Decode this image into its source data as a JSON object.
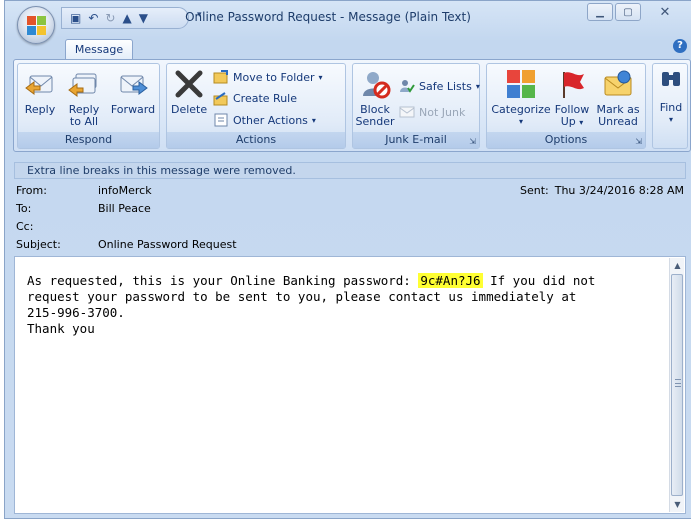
{
  "window": {
    "title": "Online Password Request - Message (Plain Text)"
  },
  "quick_access": {
    "icons": [
      "save-icon",
      "undo-icon",
      "redo-icon",
      "previous-item-icon",
      "next-item-icon"
    ],
    "customize_label": "▾"
  },
  "tabs": [
    {
      "label": "Message",
      "active": true
    }
  ],
  "ribbon": {
    "groups": {
      "respond": {
        "label": "Respond",
        "reply": "Reply",
        "reply_all_line1": "Reply",
        "reply_all_line2": "to All",
        "forward": "Forward"
      },
      "actions": {
        "label": "Actions",
        "delete": "Delete",
        "move_to_folder": "Move to Folder",
        "create_rule": "Create Rule",
        "other_actions": "Other Actions"
      },
      "junk": {
        "label": "Junk E-mail",
        "block_line1": "Block",
        "block_line2": "Sender",
        "safe_lists": "Safe Lists",
        "not_junk": "Not Junk"
      },
      "options": {
        "label": "Options",
        "categorize": "Categorize",
        "follow_up_line1": "Follow",
        "follow_up_line2": "Up",
        "mark_unread_line1": "Mark as",
        "mark_unread_line2": "Unread"
      },
      "find": {
        "find": "Find"
      }
    }
  },
  "infobar": {
    "text": "Extra line breaks in this message were removed."
  },
  "header": {
    "from_label": "From:",
    "from_value": "infoMerck",
    "sent_label": "Sent:",
    "sent_value": "Thu 3/24/2016 8:28 AM",
    "to_label": "To:",
    "to_value": "Bill Peace",
    "cc_label": "Cc:",
    "cc_value": "",
    "subject_label": "Subject:",
    "subject_value": "Online Password Request"
  },
  "body": {
    "pre_password": "As requested, this is your Online Banking password: ",
    "password": "9c#An?J6",
    "post_password": " If you did not\nrequest your password to be sent to you, please contact us immediately at\n215-996-3700.\nThank you"
  },
  "colors": {
    "highlight": "#ffff33",
    "ribbon_bg": "#dde9f8",
    "accent_text": "#15387a"
  }
}
